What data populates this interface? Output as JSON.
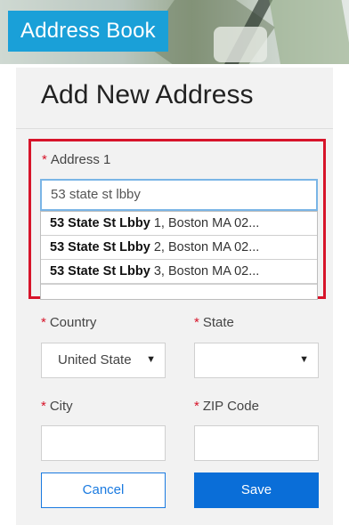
{
  "header": {
    "title": "Address Book"
  },
  "panel": {
    "title": "Add New Address"
  },
  "address": {
    "label": "Address 1",
    "value": "53 state st lbby",
    "suggestions": [
      {
        "match": "53 State St Lbby",
        "rest": " 1, Boston MA 02..."
      },
      {
        "match": "53 State St Lbby",
        "rest": " 2, Boston MA 02..."
      },
      {
        "match": "53 State St Lbby",
        "rest": " 3, Boston MA 02..."
      }
    ]
  },
  "country": {
    "label": "Country",
    "value": "United State"
  },
  "state": {
    "label": "State",
    "value": ""
  },
  "city": {
    "label": "City"
  },
  "zip": {
    "label": "ZIP Code"
  },
  "buttons": {
    "cancel": "Cancel",
    "save": "Save"
  },
  "required_mark": "*",
  "colors": {
    "accent": "#1aa0d8",
    "primary": "#0a6ed8",
    "highlight": "#d7142a"
  }
}
